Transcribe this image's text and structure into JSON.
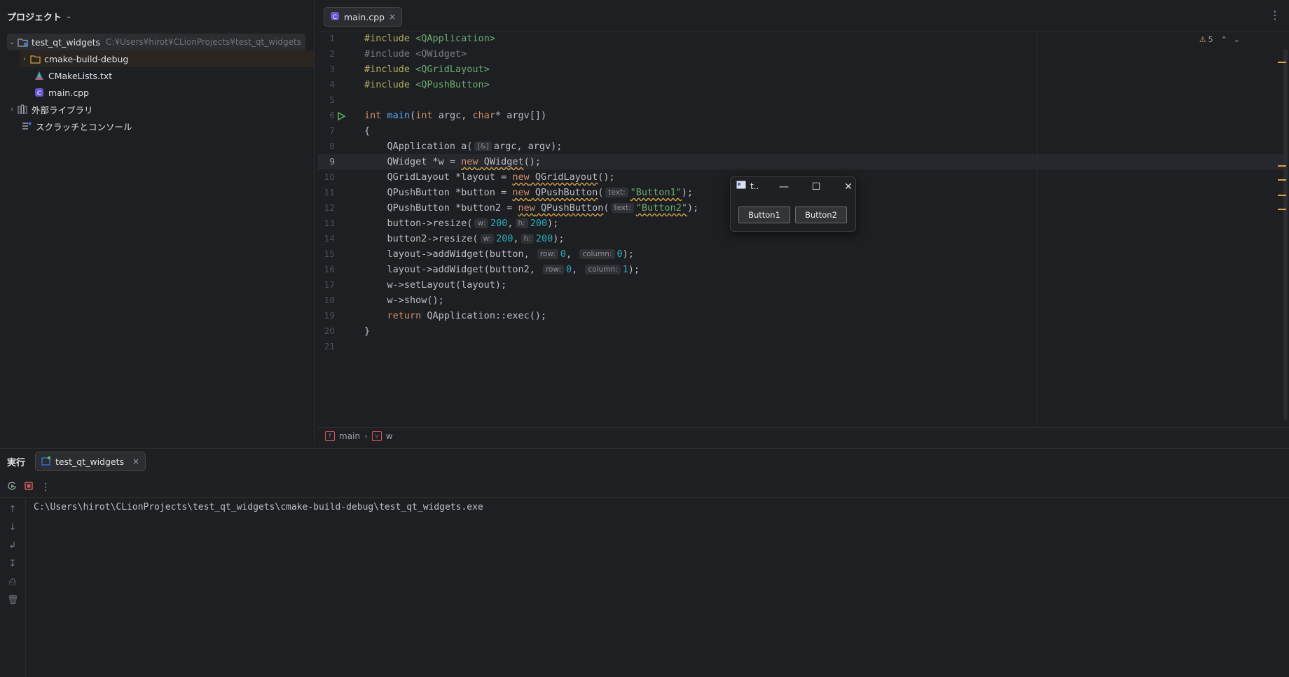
{
  "project": {
    "header": "プロジェクト",
    "root": {
      "name": "test_qt_widgets",
      "path": "C:¥Users¥hirot¥CLionProjects¥test_qt_widgets"
    },
    "items": [
      "cmake-build-debug",
      "CMakeLists.txt",
      "main.cpp"
    ],
    "external": "外部ライブラリ",
    "scratch": "スクラッチとコンソール"
  },
  "editor": {
    "tab": "main.cpp",
    "warnings": "5",
    "breadcrumb": [
      "main",
      "w"
    ],
    "lines": [
      "1",
      "2",
      "3",
      "4",
      "5",
      "6",
      "7",
      "8",
      "9",
      "10",
      "11",
      "12",
      "13",
      "14",
      "15",
      "16",
      "17",
      "18",
      "19",
      "20",
      "21"
    ]
  },
  "code": {
    "l1a": "#include ",
    "l1b": "<QApplication>",
    "l2": "#include <QWidget>",
    "l3a": "#include ",
    "l3b": "<QGridLayout>",
    "l4a": "#include ",
    "l4b": "<QPushButton>",
    "l6": [
      "int",
      "main",
      "(",
      "int",
      " argc, ",
      "char",
      "* argv[])"
    ],
    "l7": "{",
    "l8a": "    QApplication a(",
    "l8h": "[&]",
    "l8b": "argc, argv);",
    "l9a": "    QWidget *w = ",
    "l9k": "new",
    "l9b": " QWidget",
    "l9c": "();",
    "l10a": "    QGridLayout *layout = ",
    "l10k": "new",
    "l10b": " QGridLayout",
    "l10c": "();",
    "l11a": "    QPushButton *button = ",
    "l11k": "new",
    "l11b": " QPushButton",
    "l11c": "(",
    "l11h": "text:",
    "l11s": "\"Button1\"",
    "l11d": ");",
    "l12a": "    QPushButton *button2 = ",
    "l12k": "new",
    "l12b": " QPushButton",
    "l12c": "(",
    "l12h": "text:",
    "l12s": "\"Button2\"",
    "l12d": ");",
    "l13a": "    button->resize(",
    "l13hw": "w:",
    "l13n1": "200",
    "l13m": ",",
    "l13hh": "h:",
    "l13n2": "200",
    "l13d": ");",
    "l14a": "    button2->resize(",
    "l14hw": "w:",
    "l14n1": "200",
    "l14m": ",",
    "l14hh": "h:",
    "l14n2": "200",
    "l14d": ");",
    "l15a": "    layout->addWidget(button, ",
    "l15hr": "row:",
    "l15n1": "0",
    "l15m": ", ",
    "l15hc": "column:",
    "l15n2": "0",
    "l15d": ");",
    "l16a": "    layout->addWidget(button2, ",
    "l16hr": "row:",
    "l16n1": "0",
    "l16m": ", ",
    "l16hc": "column:",
    "l16n2": "1",
    "l16d": ");",
    "l17": "    w->setLayout(layout);",
    "l18": "    w->show();",
    "l19k": "    return",
    "l19b": " QApplication::exec();",
    "l20": "}"
  },
  "qt_window": {
    "title": "t..",
    "button1": "Button1",
    "button2": "Button2"
  },
  "run": {
    "title": "実行",
    "tab": "test_qt_widgets",
    "output": "C:\\Users\\hirot\\CLionProjects\\test_qt_widgets\\cmake-build-debug\\test_qt_widgets.exe"
  },
  "colors": {
    "accent": "#3574f0",
    "run_green": "#5fb865",
    "stop_red": "#d15b5b",
    "warning": "#d5a24a"
  }
}
